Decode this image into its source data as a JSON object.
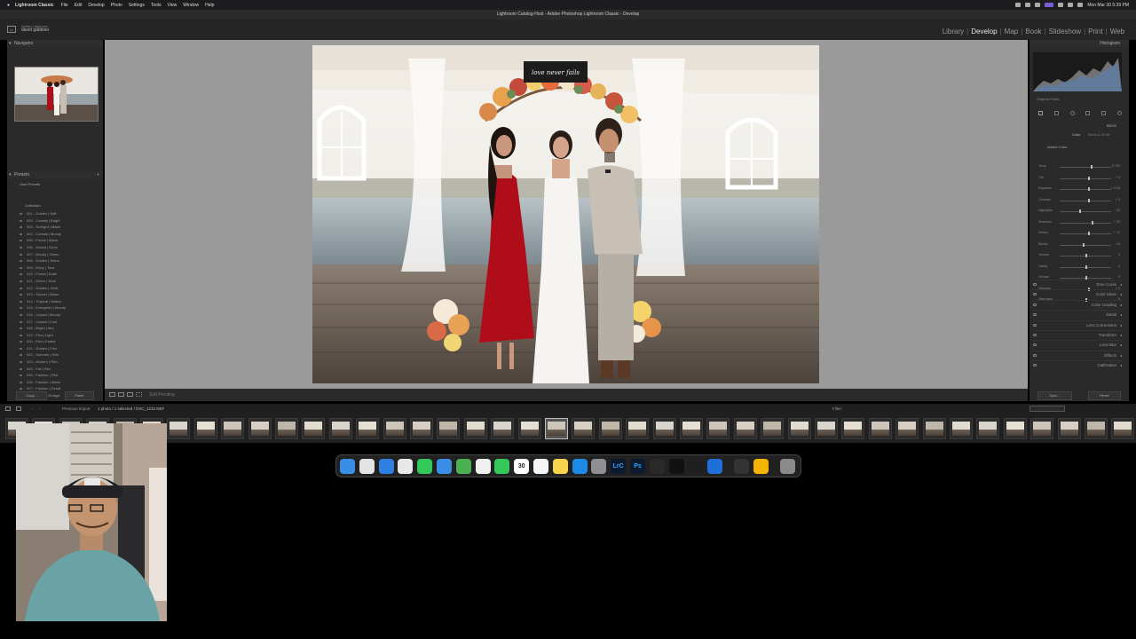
{
  "menubar": {
    "app": "Lightroom Classic",
    "items": [
      "File",
      "Edit",
      "Develop",
      "Photo",
      "Settings",
      "Tools",
      "View",
      "Window",
      "Help"
    ],
    "clock": "Mon Mar 30  5:39 PM"
  },
  "window": {
    "title": "Lightroom Catalog-Host - Adobe Photoshop Lightroom Classic - Develop"
  },
  "identity": {
    "catalog_line1": "Adobe Lightroom",
    "catalog_line2": "david gabbion"
  },
  "modules": {
    "items": [
      {
        "label": "Library",
        "active": false
      },
      {
        "label": "Develop",
        "active": true
      },
      {
        "label": "Map",
        "active": false
      },
      {
        "label": "Book",
        "active": false
      },
      {
        "label": "Slideshow",
        "active": false
      },
      {
        "label": "Print",
        "active": false
      },
      {
        "label": "Web",
        "active": false
      }
    ]
  },
  "left_panel": {
    "navigator_label": "Navigator",
    "presets_label": "Presets",
    "user_presets_label": "User Presets",
    "collection_label": "Collection",
    "presets": [
      "001 - Golden | Soft",
      "002 - Coastal | Bright",
      "003 - Sunlight | Matte",
      "004 - Coastal | Moody",
      "005 - Forest | Warm",
      "006 - Desert | Dune",
      "007 - Moody | Green",
      "008 - Golden | Warm",
      "009 - Deep | Tone",
      "010 - Forest | Earth",
      "011 - Green | Tone",
      "012 - Golden | Vivid",
      "013 - Sunset | Warm",
      "014 - Tropical | Muted",
      "015 - Evergreen | Moody",
      "016 - Crystal | Moody",
      "017 - Crystal | Cool",
      "018 - Bright | Airy",
      "019 - Film | Light",
      "020 - Film | Faded",
      "021 - Golden | Film",
      "022 - Summer | Film",
      "023 - Modern | Film",
      "024 - Fall | Film",
      "025 - Fashion | Film",
      "026 - Fashion | Warm",
      "027 - Fashion | Desat",
      "028 - Bright | Vintage"
    ],
    "copy_label": "Copy...",
    "paste_label": "Paste"
  },
  "toolbar": {
    "soft_proofing_label": "Soft Proofing"
  },
  "right_panel": {
    "histogram_label": "Histogram",
    "original_photo_label": "Original Photo",
    "basic_label": "Basic",
    "treatment_label": "Color",
    "treatment_alt": "Black & White",
    "profile_label": "Adobe Color",
    "sliders": [
      {
        "label": "Temp",
        "value": "5,750",
        "pos": 0.6
      },
      {
        "label": "Tint",
        "value": "+ 4",
        "pos": 0.55
      },
      {
        "label": "Exposure",
        "value": "+ 0.25",
        "pos": 0.55
      },
      {
        "label": "Contrast",
        "value": "+ 5",
        "pos": 0.55
      },
      {
        "label": "Highlights",
        "value": "- 20",
        "pos": 0.38
      },
      {
        "label": "Shadows",
        "value": "+ 20",
        "pos": 0.62
      },
      {
        "label": "Whites",
        "value": "+ 12",
        "pos": 0.56
      },
      {
        "label": "Blacks",
        "value": "- 10",
        "pos": 0.45
      },
      {
        "label": "Texture",
        "value": "0",
        "pos": 0.5
      },
      {
        "label": "Clarity",
        "value": "0",
        "pos": 0.5
      },
      {
        "label": "Dehaze",
        "value": "0",
        "pos": 0.5
      },
      {
        "label": "Vibrance",
        "value": "+ 5",
        "pos": 0.55
      },
      {
        "label": "Saturation",
        "value": "0",
        "pos": 0.5
      }
    ],
    "sections": [
      "Tone Curve",
      "Color Mixer",
      "Color Grading",
      "Detail",
      "Lens Corrections",
      "Transform",
      "Lens Blur",
      "Effects",
      "Calibration"
    ],
    "previous_label": "Sync...",
    "reset_label": "Reset"
  },
  "filmstrip": {
    "folder_label": "Previous Import",
    "count_label": "1 photo / 1 selected / DSC_1232.NEF",
    "filter_label": "Filter:"
  },
  "dock": {
    "apps": [
      "Finder",
      "Launchpad",
      "Safari",
      "Chrome",
      "Messages",
      "Mail",
      "Maps",
      "Photos",
      "FaceTime",
      "Calendar",
      "Reminders",
      "Notes",
      "App Store",
      "System Settings",
      "Lightroom Classic",
      "Photoshop",
      "DaVinci Resolve",
      "CapCut",
      "Final Cut",
      "Browser",
      "Activity",
      "Utilities",
      "Trash"
    ],
    "calendar_day": "30",
    "lrc_text": "LrC",
    "ps_text": "Ps"
  },
  "photo": {
    "sign_text": "love never fails"
  },
  "colors": {
    "dress_red": "#b00d1b",
    "lightroom_panel": "#2a2a2a",
    "canvas": "#9a9a9a"
  }
}
